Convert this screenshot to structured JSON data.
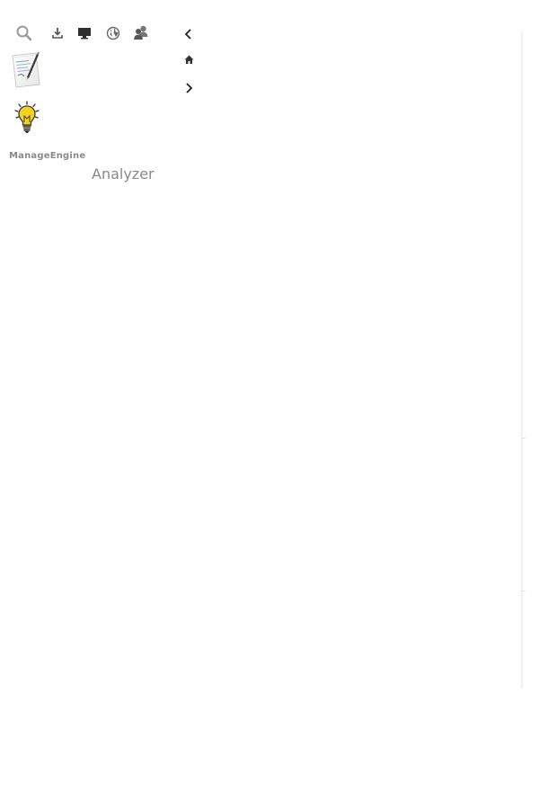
{
  "toolbar": {
    "icons": [
      {
        "name": "search-icon"
      },
      {
        "name": "download-icon"
      },
      {
        "name": "monitor-icon"
      },
      {
        "name": "globe-icon"
      },
      {
        "name": "users-icon"
      }
    ]
  },
  "nav": {
    "back_icon": "chevron-left-icon",
    "home_icon": "home-icon",
    "forward_icon": "chevron-right-icon"
  },
  "apps": [
    {
      "name": "notepad-pen-icon"
    },
    {
      "name": "lightbulb-icon"
    }
  ],
  "brand": {
    "company": "ManageEngine",
    "product": "Analyzer"
  },
  "colors": {
    "icon_gray": "#8c8c8c",
    "icon_dark": "#3a3a3a",
    "brand_gray": "#8a8a8a",
    "bulb_yellow": "#f5d21c"
  }
}
